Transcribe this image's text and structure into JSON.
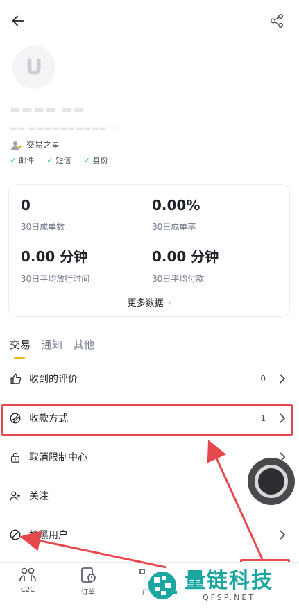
{
  "profile": {
    "avatar_letter": "U",
    "badge": "交易之星",
    "verifications": [
      "邮件",
      "短信",
      "身份"
    ]
  },
  "stats": {
    "orders_value": "0",
    "orders_label": "30日成单数",
    "rate_value": "0.00%",
    "rate_label": "30日成单率",
    "release_value": "0.00 分钟",
    "release_label": "30日平均放行时间",
    "pay_value": "0.00 分钟",
    "pay_label": "30日平均付款",
    "more": "更多数据"
  },
  "tabs": [
    "交易",
    "通知",
    "其他"
  ],
  "menu": [
    {
      "label": "收到的评价",
      "count": "0",
      "icon": "thumbs-up-icon"
    },
    {
      "label": "收款方式",
      "count": "1",
      "icon": "payment-icon"
    },
    {
      "label": "取消限制中心",
      "count": "",
      "icon": "lock-icon"
    },
    {
      "label": "关注",
      "count": "",
      "icon": "add-user-icon"
    },
    {
      "label": "拉黑用户",
      "count": "",
      "icon": "block-icon"
    }
  ],
  "bottom_nav": [
    {
      "label": "C2C",
      "icon": "c2c-icon"
    },
    {
      "label": "订单",
      "icon": "orders-icon"
    },
    {
      "label": "广",
      "icon": "ads-icon"
    }
  ],
  "watermark": {
    "title": "量链科技",
    "subtitle": "QFSP.NET"
  },
  "colors": {
    "accent": "#f0b90b",
    "annotation": "#e5484d",
    "success": "#2ebd85",
    "watermark": "#1ba6a0"
  }
}
